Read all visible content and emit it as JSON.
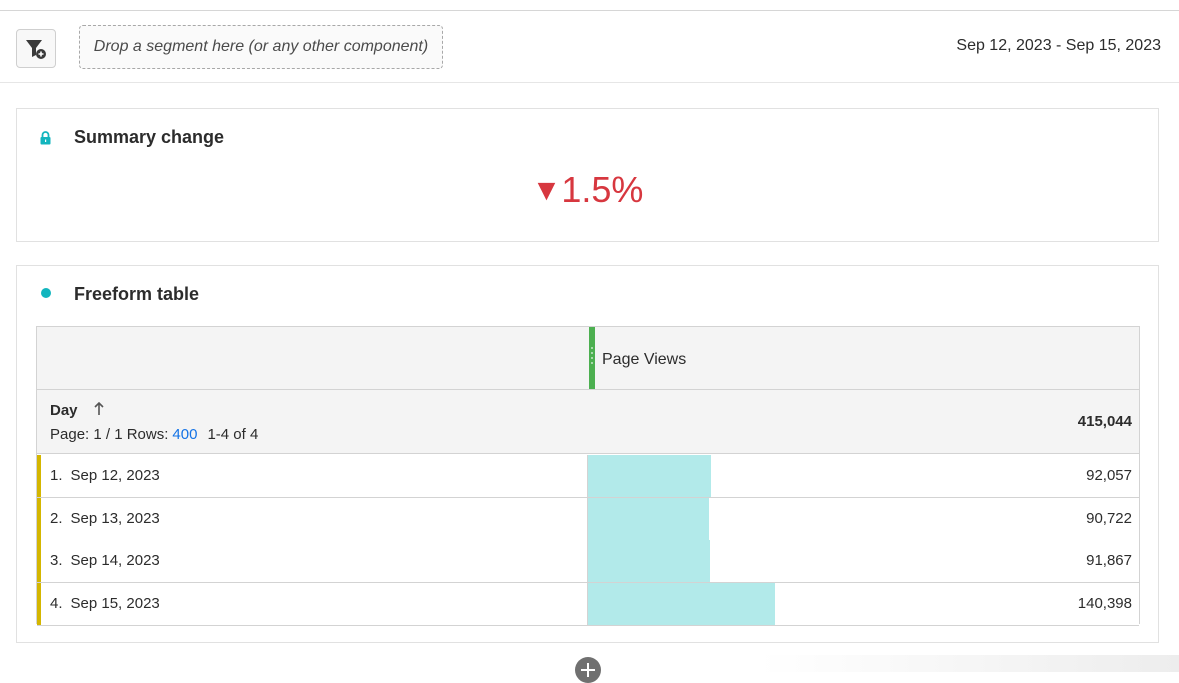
{
  "segment_bar": {
    "dropzone_text": "Drop a segment here (or any other component)",
    "date_range": "Sep 12, 2023 - Sep 15, 2023"
  },
  "summary_panel": {
    "title": "Summary change",
    "change_direction": "down",
    "change_value": "1.5%",
    "change_color": "#d7373f"
  },
  "freeform_panel": {
    "title": "Freeform table",
    "metric_header": "Page Views",
    "metric_color": "#4caf50",
    "dimension": "Day",
    "sort": "ascending",
    "pager": {
      "page_label": "Page: 1 / 1 Rows:",
      "rows_per_page": "400",
      "range": "1-4 of 4"
    },
    "total": "415,044",
    "rows": [
      {
        "index": "1.",
        "day": "Sep 12, 2023",
        "value": "92,057",
        "raw": 92057
      },
      {
        "index": "2.",
        "day": "Sep 13, 2023",
        "value": "90,722",
        "raw": 90722
      },
      {
        "index": "3.",
        "day": "Sep 14, 2023",
        "value": "91,867",
        "raw": 91867
      },
      {
        "index": "4.",
        "day": "Sep 15, 2023",
        "value": "140,398",
        "raw": 140398
      }
    ],
    "bar_color": "#b2eaea"
  },
  "icons": {
    "filter": "filter-add-icon",
    "lock": "lock-icon",
    "status": "status-dot-icon",
    "sort": "arrow-up-icon",
    "add": "add-panel-icon"
  }
}
